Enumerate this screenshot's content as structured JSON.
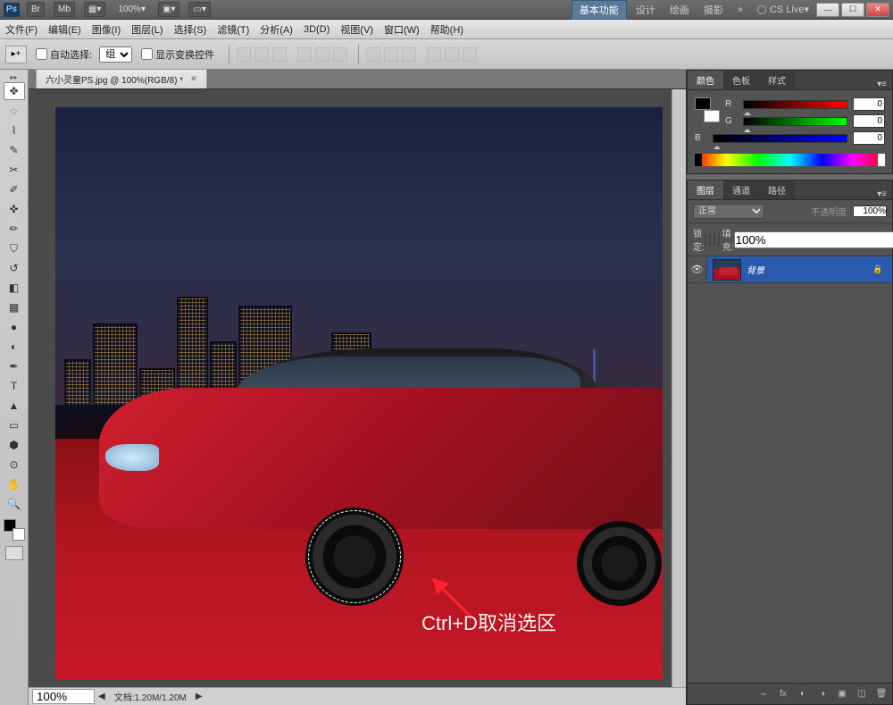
{
  "titlebar": {
    "ps": "Ps",
    "icons": [
      "Br",
      "Mb"
    ],
    "zoom": "100%",
    "workspaces": {
      "active": "基本功能",
      "others": [
        "设计",
        "绘画",
        "摄影"
      ],
      "more": "»"
    },
    "cslive": "CS Live"
  },
  "menubar": [
    "文件(F)",
    "编辑(E)",
    "图像(I)",
    "图层(L)",
    "选择(S)",
    "滤镜(T)",
    "分析(A)",
    "3D(D)",
    "视图(V)",
    "窗口(W)",
    "帮助(H)"
  ],
  "optionsbar": {
    "auto_select": "自动选择:",
    "group": "组",
    "show_transform": "显示变换控件"
  },
  "document": {
    "tab_title": "六小灵童PS.jpg @ 100%(RGB/8) *",
    "annotation": "Ctrl+D取消选区"
  },
  "statusbar": {
    "zoom": "100%",
    "docinfo": "文档:1.20M/1.20M"
  },
  "color_panel": {
    "tabs": [
      "颜色",
      "色板",
      "样式"
    ],
    "active_tab": 0,
    "r_label": "R",
    "g_label": "G",
    "b_label": "B",
    "r": "0",
    "g": "0",
    "b": "0"
  },
  "layers_panel": {
    "tabs": [
      "图层",
      "通道",
      "路径"
    ],
    "active_tab": 0,
    "blend_mode": "正常",
    "opacity_label": "不透明度:",
    "opacity": "100%",
    "lock_label": "锁定:",
    "fill_label": "填充:",
    "fill": "100%",
    "layers": [
      {
        "name": "背景",
        "visible": true,
        "locked": true
      }
    ]
  }
}
